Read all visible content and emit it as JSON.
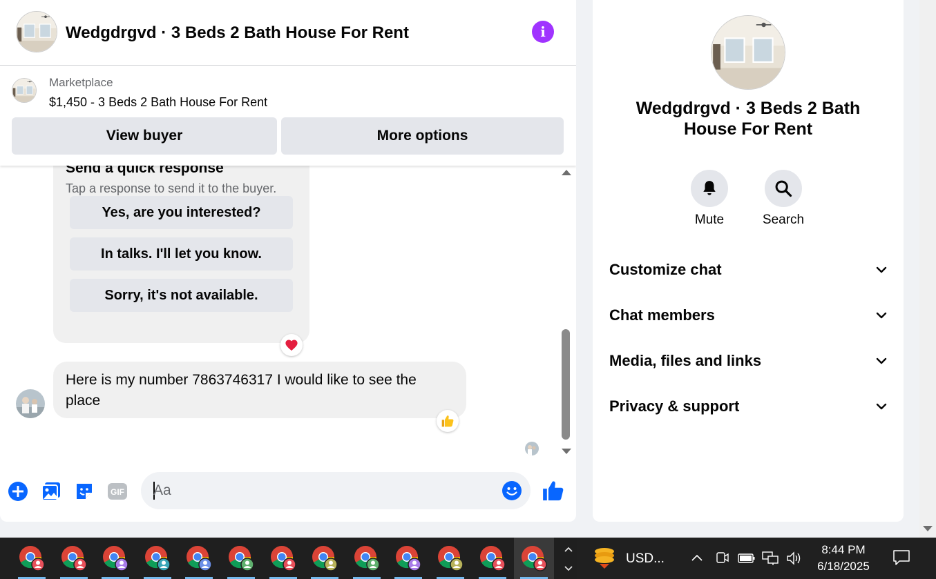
{
  "chat": {
    "title": "Wedgdrgvd · 3 Beds 2 Bath House For Rent",
    "marketplace_label": "Marketplace",
    "listing": "$1,450 - 3 Beds 2 Bath House For Rent",
    "view_buyer": "View buyer",
    "more_options": "More options"
  },
  "quick_response": {
    "title": "Send a quick response",
    "subtitle": "Tap a response to send it to the buyer.",
    "options": [
      "Yes, are you interested?",
      "In talks. I'll let you know.",
      "Sorry, it's not available."
    ]
  },
  "message": {
    "text": "Here is my number 7863746317 I would like to see the place"
  },
  "composer": {
    "placeholder": "Aa",
    "gif_label": "GIF"
  },
  "details": {
    "title": "Wedgdrgvd · 3 Beds 2 Bath House For Rent",
    "mute": "Mute",
    "search": "Search",
    "sections": [
      "Customize chat",
      "Chat members",
      "Media, files and links",
      "Privacy & support"
    ]
  },
  "taskbar": {
    "tray_label": "USD...",
    "time": "8:44 PM",
    "date": "6/18/2025"
  },
  "colors": {
    "accent": "#0866ff",
    "info": "#a033ff",
    "heart": "#e41e3f"
  }
}
